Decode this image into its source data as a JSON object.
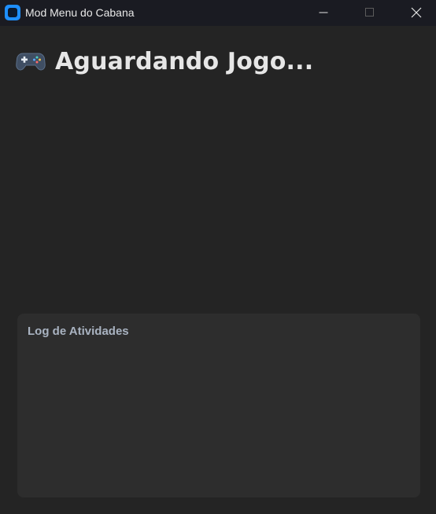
{
  "window": {
    "title": "Mod Menu do Cabana",
    "app_icon": "app-logo-icon",
    "controls": {
      "minimize_icon": "minimize-icon",
      "maximize_icon": "maximize-icon",
      "close_icon": "close-icon"
    }
  },
  "main": {
    "status_icon": "gamepad-icon",
    "title": "Aguardando Jogo..."
  },
  "log": {
    "title": "Log de Atividades",
    "entries": []
  },
  "colors": {
    "background": "#242424",
    "titlebar": "#1a1b22",
    "panel": "#2d2d2d",
    "accent": "#1e8fff",
    "log_title": "#a9b3c1"
  }
}
